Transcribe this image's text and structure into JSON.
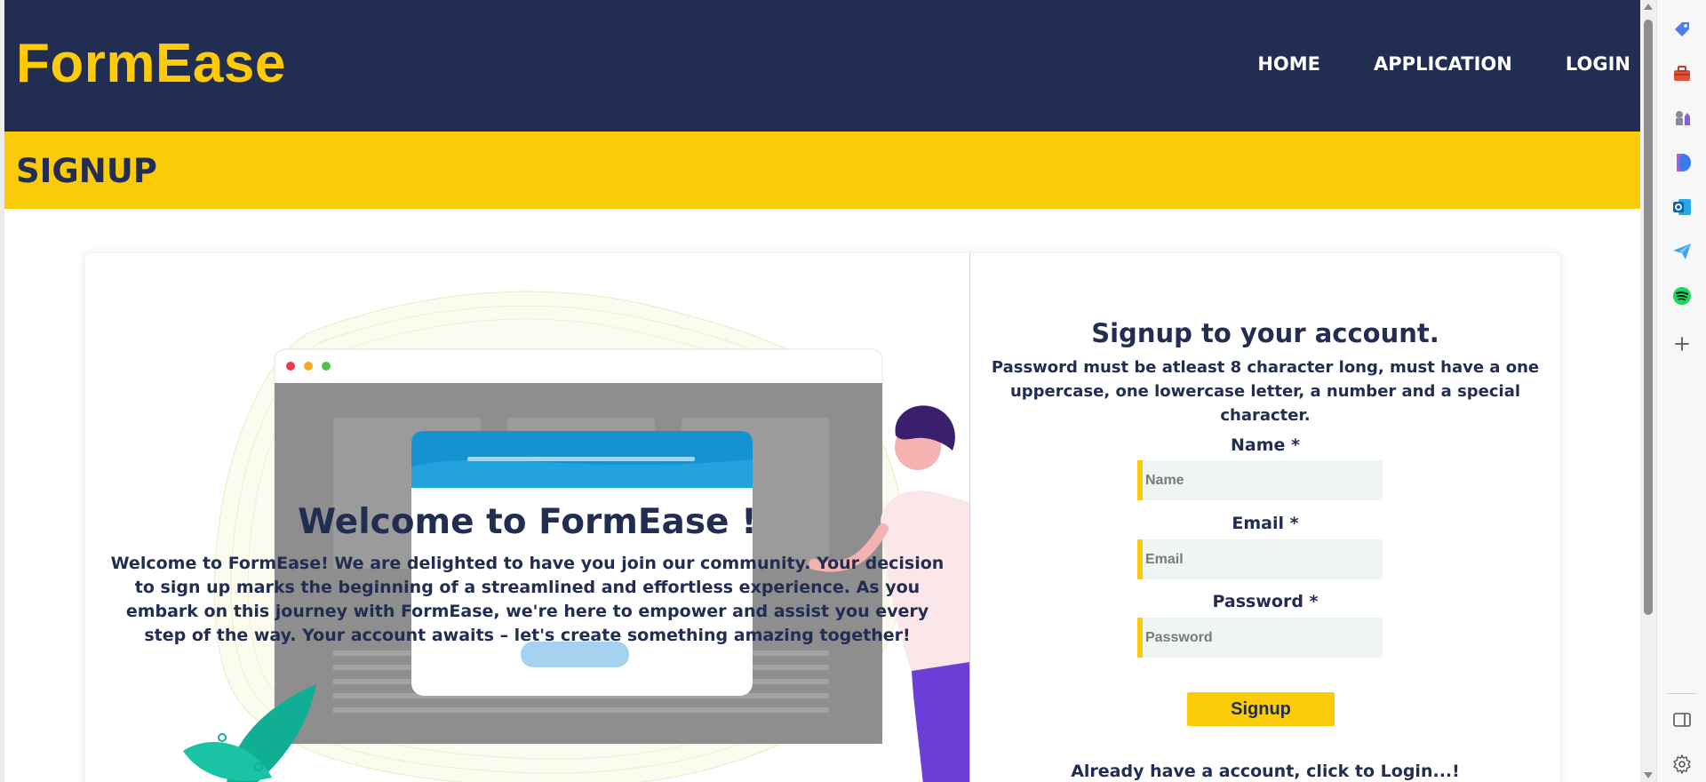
{
  "navbar": {
    "brand": "FormEase",
    "links": [
      "HOME",
      "APPLICATION",
      "LOGIN"
    ]
  },
  "banner": {
    "title": "SIGNUP"
  },
  "welcome": {
    "title": "Welcome to FormEase !",
    "text": "Welcome to FormEase! We are delighted to have you join our community. Your decision to sign up marks the beginning of a streamlined and effortless experience. As you embark on this journey with FormEase, we're here to empower and assist you every step of the way. Your account awaits – let's create something amazing together!"
  },
  "form": {
    "title": "Signup to your account.",
    "note": "Password must be atleast 8 character long, must have a one uppercase, one lowercase letter, a number and a special character.",
    "name_label": "Name *",
    "name_placeholder": "Name",
    "email_label": "Email *",
    "email_placeholder": "Email",
    "password_label": "Password *",
    "password_placeholder": "Password",
    "submit_label": "Signup",
    "login_prompt": "Already have a account, click to Login...!"
  },
  "colors": {
    "navy": "#222d52",
    "yellow": "#fccb07",
    "input_bg": "#eef5f3"
  },
  "edge_sidebar": {
    "icons": [
      "tag-icon",
      "toolbox-icon",
      "chess-icon",
      "copilot-icon",
      "outlook-icon",
      "send-icon",
      "spotify-icon",
      "add-icon",
      "panel-icon",
      "settings-icon"
    ]
  }
}
